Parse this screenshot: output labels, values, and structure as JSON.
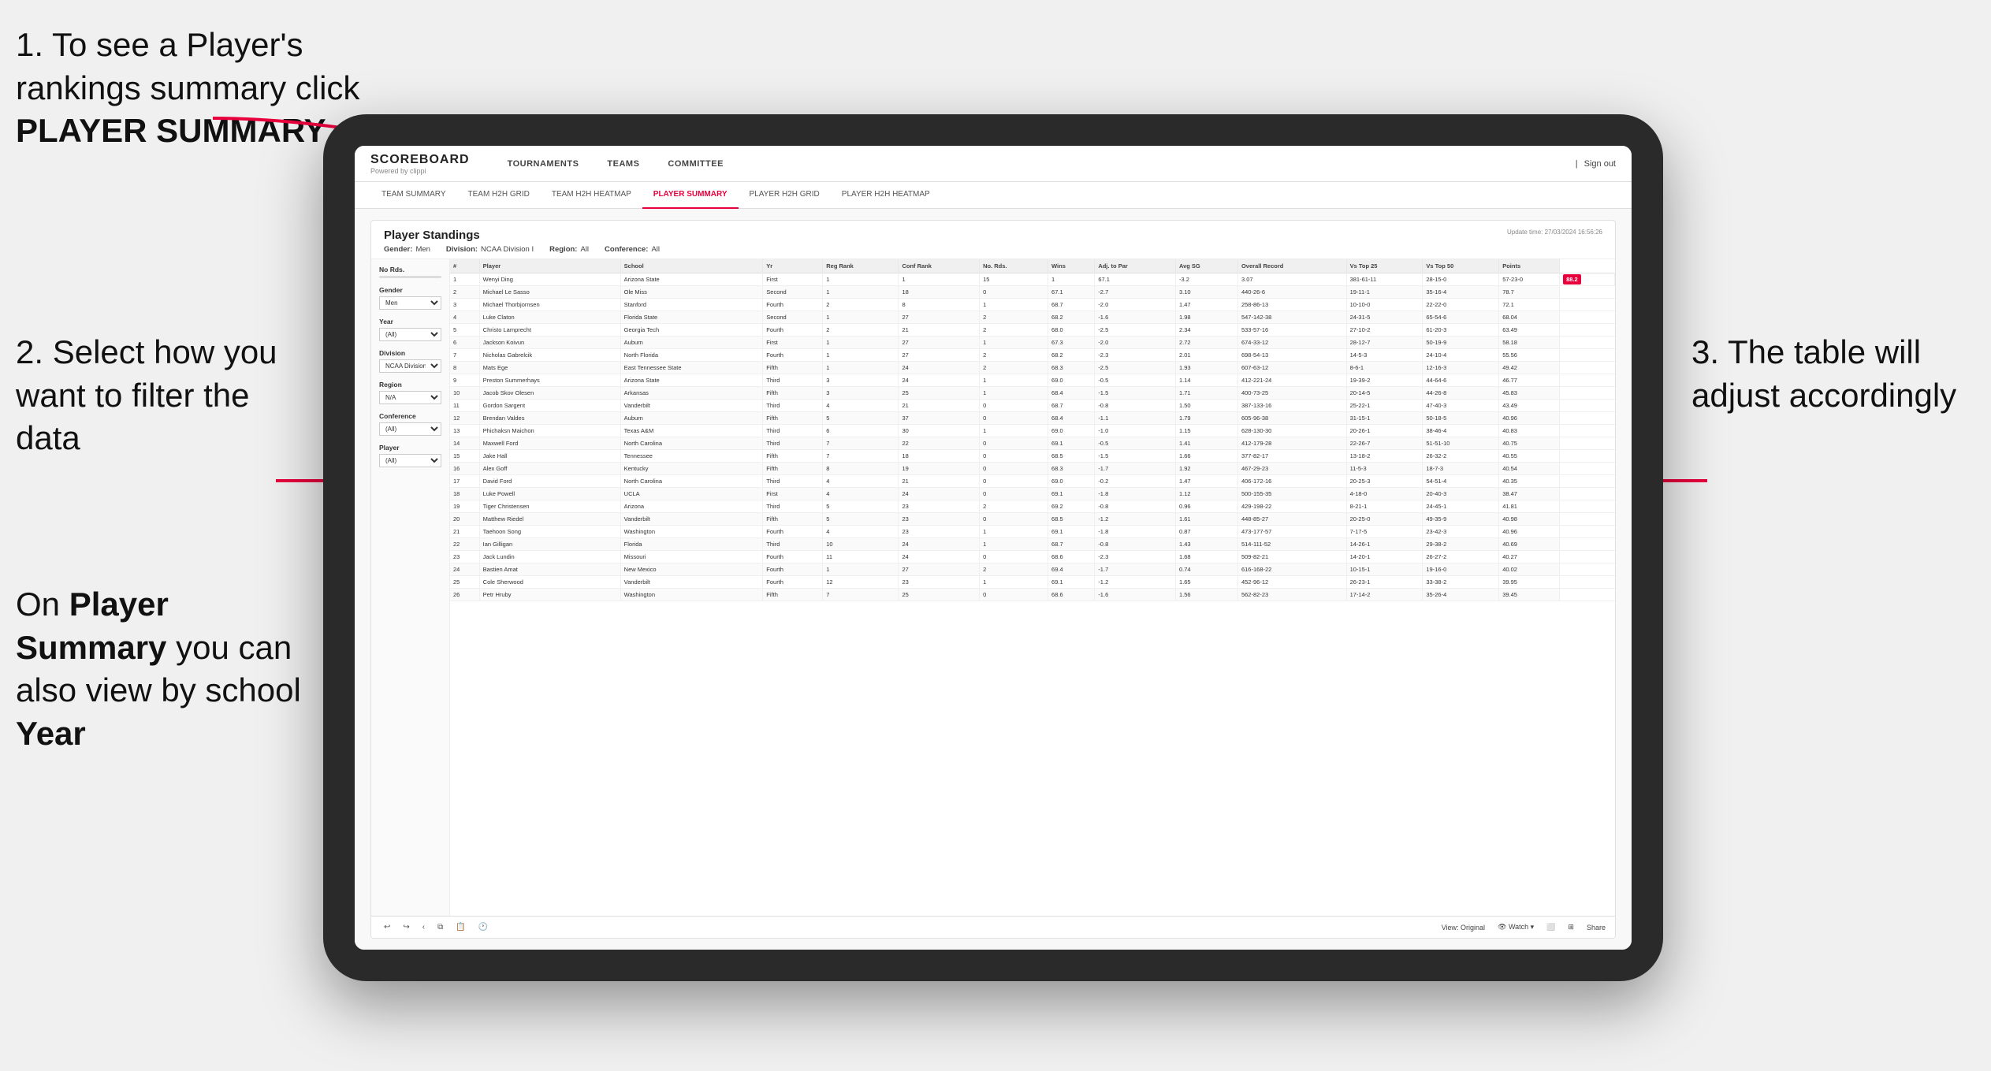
{
  "annotations": {
    "top_left": {
      "number": "1.",
      "text": "To see a Player's rankings summary click ",
      "bold": "PLAYER SUMMARY"
    },
    "mid_left": {
      "number": "2.",
      "text": "Select how you want to filter the data"
    },
    "bottom_left": {
      "text": "On ",
      "bold1": "Player Summary",
      "text2": " you can also view by school ",
      "bold2": "Year"
    },
    "right": {
      "number": "3.",
      "text": "The table will adjust accordingly"
    }
  },
  "app": {
    "logo": "SCOREBOARD",
    "logo_sub": "Powered by clippi",
    "nav": [
      "TOURNAMENTS",
      "TEAMS",
      "COMMITTEE"
    ],
    "nav_right": [
      "Sign out"
    ],
    "sub_nav": [
      "TEAM SUMMARY",
      "TEAM H2H GRID",
      "TEAM H2H HEATMAP",
      "PLAYER SUMMARY",
      "PLAYER H2H GRID",
      "PLAYER H2H HEATMAP"
    ],
    "active_sub": "PLAYER SUMMARY"
  },
  "panel": {
    "title": "Player Standings",
    "update_time": "Update time: 27/03/2024 16:56:26",
    "filters": {
      "gender_label": "Gender:",
      "gender_value": "Men",
      "division_label": "Division:",
      "division_value": "NCAA Division I",
      "region_label": "Region:",
      "region_value": "All",
      "conference_label": "Conference:",
      "conference_value": "All"
    }
  },
  "sidebar": {
    "no_rds_label": "No Rds.",
    "gender_label": "Gender",
    "gender_value": "Men",
    "year_label": "Year",
    "year_value": "(All)",
    "division_label": "Division",
    "division_value": "NCAA Division I",
    "region_label": "Region",
    "region_value": "N/A",
    "conference_label": "Conference",
    "conference_value": "(All)",
    "player_label": "Player",
    "player_value": "(All)"
  },
  "table": {
    "headers": [
      "#",
      "Player",
      "School",
      "Yr",
      "Reg Rank",
      "Conf Rank",
      "No. Rds.",
      "Wins",
      "Adj. to Par",
      "Avg SG",
      "Overall Record",
      "Vs Top 25",
      "Vs Top 50",
      "Points"
    ],
    "rows": [
      [
        "1",
        "Wenyi Ding",
        "Arizona State",
        "First",
        "1",
        "1",
        "15",
        "1",
        "67.1",
        "-3.2",
        "3.07",
        "381-61-11",
        "28-15-0",
        "57-23-0",
        "88.2"
      ],
      [
        "2",
        "Michael Le Sasso",
        "Ole Miss",
        "Second",
        "1",
        "18",
        "0",
        "67.1",
        "-2.7",
        "3.10",
        "440-26-6",
        "19-11-1",
        "35-16-4",
        "78.7"
      ],
      [
        "3",
        "Michael Thorbjornsen",
        "Stanford",
        "Fourth",
        "2",
        "8",
        "1",
        "68.7",
        "-2.0",
        "1.47",
        "258-86-13",
        "10-10-0",
        "22-22-0",
        "72.1"
      ],
      [
        "4",
        "Luke Claton",
        "Florida State",
        "Second",
        "1",
        "27",
        "2",
        "68.2",
        "-1.6",
        "1.98",
        "547-142-38",
        "24-31-5",
        "65-54-6",
        "68.04"
      ],
      [
        "5",
        "Christo Lamprecht",
        "Georgia Tech",
        "Fourth",
        "2",
        "21",
        "2",
        "68.0",
        "-2.5",
        "2.34",
        "533-57-16",
        "27-10-2",
        "61-20-3",
        "63.49"
      ],
      [
        "6",
        "Jackson Koivun",
        "Auburn",
        "First",
        "1",
        "27",
        "1",
        "67.3",
        "-2.0",
        "2.72",
        "674-33-12",
        "28-12-7",
        "50-19-9",
        "58.18"
      ],
      [
        "7",
        "Nicholas Gabrelcik",
        "North Florida",
        "Fourth",
        "1",
        "27",
        "2",
        "68.2",
        "-2.3",
        "2.01",
        "698-54-13",
        "14-5-3",
        "24-10-4",
        "55.56"
      ],
      [
        "8",
        "Mats Ege",
        "East Tennessee State",
        "Fifth",
        "1",
        "24",
        "2",
        "68.3",
        "-2.5",
        "1.93",
        "607-63-12",
        "8-6-1",
        "12-16-3",
        "49.42"
      ],
      [
        "9",
        "Preston Summerhays",
        "Arizona State",
        "Third",
        "3",
        "24",
        "1",
        "69.0",
        "-0.5",
        "1.14",
        "412-221-24",
        "19-39-2",
        "44-64-6",
        "46.77"
      ],
      [
        "10",
        "Jacob Skov Olesen",
        "Arkansas",
        "Fifth",
        "3",
        "25",
        "1",
        "68.4",
        "-1.5",
        "1.71",
        "400-73-25",
        "20-14-5",
        "44-26-8",
        "45.83"
      ],
      [
        "11",
        "Gordon Sargent",
        "Vanderbilt",
        "Third",
        "4",
        "21",
        "0",
        "68.7",
        "-0.8",
        "1.50",
        "387-133-16",
        "25-22-1",
        "47-40-3",
        "43.49"
      ],
      [
        "12",
        "Brendan Valdes",
        "Auburn",
        "Fifth",
        "5",
        "37",
        "0",
        "68.4",
        "-1.1",
        "1.79",
        "605-96-38",
        "31-15-1",
        "50-18-5",
        "40.96"
      ],
      [
        "13",
        "Phichaksn Maichon",
        "Texas A&M",
        "Third",
        "6",
        "30",
        "1",
        "69.0",
        "-1.0",
        "1.15",
        "628-130-30",
        "20-26-1",
        "38-46-4",
        "40.83"
      ],
      [
        "14",
        "Maxwell Ford",
        "North Carolina",
        "Third",
        "7",
        "22",
        "0",
        "69.1",
        "-0.5",
        "1.41",
        "412-179-28",
        "22-26-7",
        "51-51-10",
        "40.75"
      ],
      [
        "15",
        "Jake Hall",
        "Tennessee",
        "Fifth",
        "7",
        "18",
        "0",
        "68.5",
        "-1.5",
        "1.66",
        "377-82-17",
        "13-18-2",
        "26-32-2",
        "40.55"
      ],
      [
        "16",
        "Alex Goff",
        "Kentucky",
        "Fifth",
        "8",
        "19",
        "0",
        "68.3",
        "-1.7",
        "1.92",
        "467-29-23",
        "11-5-3",
        "18-7-3",
        "40.54"
      ],
      [
        "17",
        "David Ford",
        "North Carolina",
        "Third",
        "4",
        "21",
        "0",
        "69.0",
        "-0.2",
        "1.47",
        "406-172-16",
        "20-25-3",
        "54-51-4",
        "40.35"
      ],
      [
        "18",
        "Luke Powell",
        "UCLA",
        "First",
        "4",
        "24",
        "0",
        "69.1",
        "-1.8",
        "1.12",
        "500-155-35",
        "4-18-0",
        "20-40-3",
        "38.47"
      ],
      [
        "19",
        "Tiger Christensen",
        "Arizona",
        "Third",
        "5",
        "23",
        "2",
        "69.2",
        "-0.8",
        "0.96",
        "429-198-22",
        "8-21-1",
        "24-45-1",
        "41.81"
      ],
      [
        "20",
        "Matthew Riedel",
        "Vanderbilt",
        "Fifth",
        "5",
        "23",
        "0",
        "68.5",
        "-1.2",
        "1.61",
        "448-85-27",
        "20-25-0",
        "49-35-9",
        "40.98"
      ],
      [
        "21",
        "Taehoon Song",
        "Washington",
        "Fourth",
        "4",
        "23",
        "1",
        "69.1",
        "-1.8",
        "0.87",
        "473-177-57",
        "7-17-5",
        "23-42-3",
        "40.96"
      ],
      [
        "22",
        "Ian Gilligan",
        "Florida",
        "Third",
        "10",
        "24",
        "1",
        "68.7",
        "-0.8",
        "1.43",
        "514-111-52",
        "14-26-1",
        "29-38-2",
        "40.69"
      ],
      [
        "23",
        "Jack Lundin",
        "Missouri",
        "Fourth",
        "11",
        "24",
        "0",
        "68.6",
        "-2.3",
        "1.68",
        "509-82-21",
        "14-20-1",
        "26-27-2",
        "40.27"
      ],
      [
        "24",
        "Bastien Amat",
        "New Mexico",
        "Fourth",
        "1",
        "27",
        "2",
        "69.4",
        "-1.7",
        "0.74",
        "616-168-22",
        "10-15-1",
        "19-16-0",
        "40.02"
      ],
      [
        "25",
        "Cole Sherwood",
        "Vanderbilt",
        "Fourth",
        "12",
        "23",
        "1",
        "69.1",
        "-1.2",
        "1.65",
        "452-96-12",
        "26-23-1",
        "33-38-2",
        "39.95"
      ],
      [
        "26",
        "Petr Hruby",
        "Washington",
        "Fifth",
        "7",
        "25",
        "0",
        "68.6",
        "-1.6",
        "1.56",
        "562-82-23",
        "17-14-2",
        "35-26-4",
        "39.45"
      ]
    ]
  },
  "toolbar": {
    "view_label": "View: Original",
    "watch_label": "Watch",
    "share_label": "Share"
  }
}
